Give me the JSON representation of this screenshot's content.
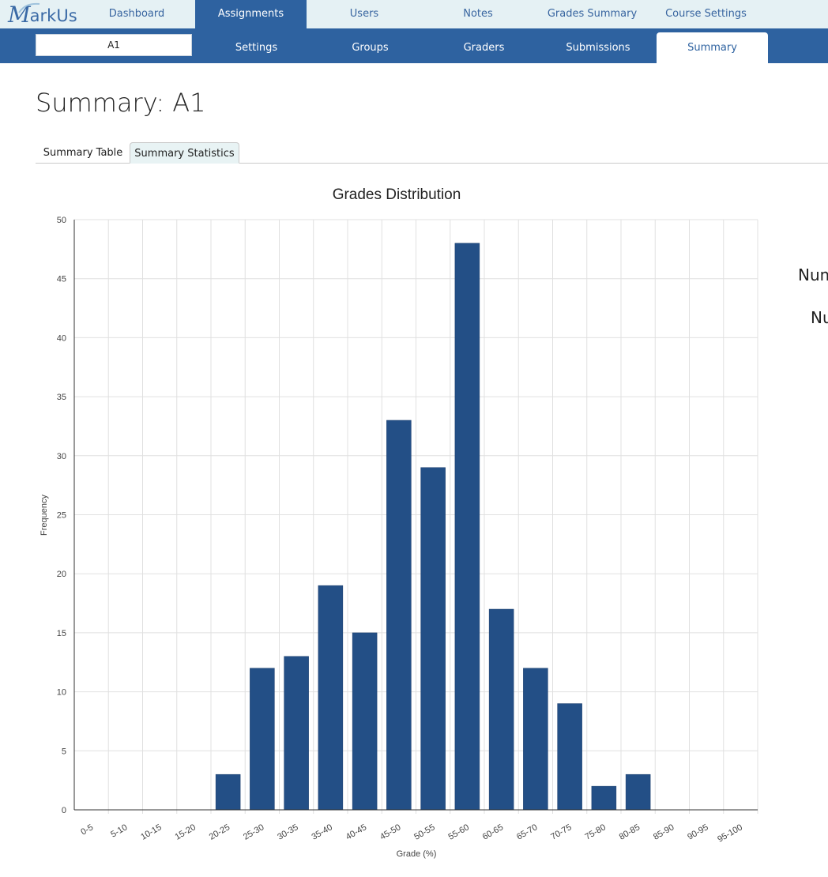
{
  "app": {
    "logo_initial": "M",
    "logo_rest": "arkUs"
  },
  "topnav": [
    {
      "label": "Dashboard"
    },
    {
      "label": "Assignments"
    },
    {
      "label": "Users"
    },
    {
      "label": "Notes"
    },
    {
      "label": "Grades Summary"
    },
    {
      "label": "Course Settings"
    }
  ],
  "subnav": {
    "assignment": "A1",
    "items": [
      {
        "label": "Settings"
      },
      {
        "label": "Groups"
      },
      {
        "label": "Graders"
      },
      {
        "label": "Submissions"
      },
      {
        "label": "Summary"
      }
    ]
  },
  "page": {
    "title": "Summary: A1"
  },
  "tabs": [
    {
      "label": "Summary Table"
    },
    {
      "label": "Summary Statistics"
    }
  ],
  "side": {
    "label1": "Num",
    "label2": "Nu"
  },
  "colors": {
    "bar": "#234f86",
    "nav_active": "#2e62a0",
    "topbar": "#e5f1f4",
    "tab_active": "#e8f3f4"
  },
  "chart_data": {
    "type": "bar",
    "title": "Grades Distribution",
    "xlabel": "Grade (%)",
    "ylabel": "Frequency",
    "ylim": [
      0,
      50
    ],
    "yticks": [
      0,
      5,
      10,
      15,
      20,
      25,
      30,
      35,
      40,
      45,
      50
    ],
    "grid": true,
    "categories": [
      "0-5",
      "5-10",
      "10-15",
      "15-20",
      "20-25",
      "25-30",
      "30-35",
      "35-40",
      "40-45",
      "45-50",
      "50-55",
      "55-60",
      "60-65",
      "65-70",
      "70-75",
      "75-80",
      "80-85",
      "85-90",
      "90-95",
      "95-100"
    ],
    "values": [
      0,
      0,
      0,
      0,
      3,
      12,
      13,
      19,
      15,
      33,
      29,
      48,
      17,
      12,
      9,
      2,
      3,
      0,
      0,
      0
    ]
  }
}
